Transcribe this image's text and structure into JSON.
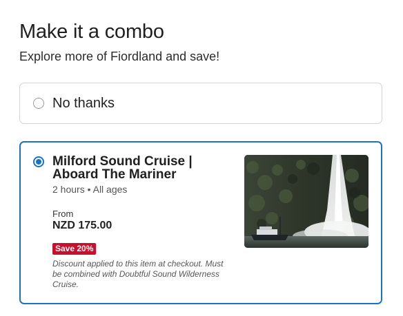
{
  "header": {
    "title": "Make it a combo",
    "subtitle": "Explore more of Fiordland and save!"
  },
  "options": {
    "no_thanks": {
      "label": "No thanks",
      "selected": false
    },
    "product": {
      "selected": true,
      "title": "Milford Sound Cruise | Aboard The Mariner",
      "meta": "2 hours • All ages",
      "from_label": "From",
      "price": "NZD 175.00",
      "discount_badge": "Save 20%",
      "note": "Discount applied to this item at checkout. Must be combined with Doubtful Sound Wilderness Cruise.",
      "image_subject": "waterfall-with-cruise-boat"
    }
  },
  "colors": {
    "accent": "#1a73c0",
    "badge": "#c8102e"
  }
}
